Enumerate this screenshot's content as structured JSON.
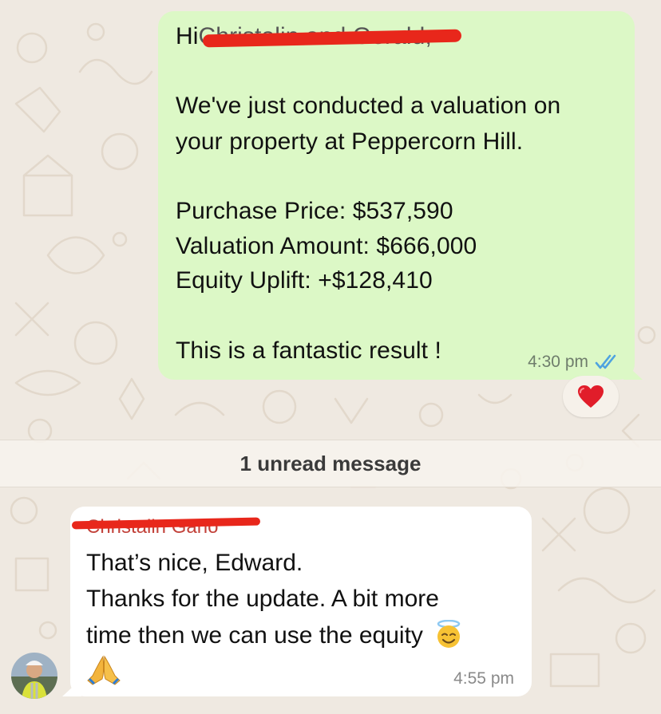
{
  "outgoing_message": {
    "greeting_prefix": "Hi",
    "greeting_redacted": "Christalin and Gerald,",
    "lines": [
      "We've just conducted a valuation on",
      "your property at Peppercorn Hill.",
      "Purchase Price: $537,590",
      "Valuation Amount: $666,000",
      "Equity Uplift: +$128,410",
      "This is a fantastic result !"
    ],
    "time": "4:30 pm",
    "status_icon": "double-check-read-icon",
    "reaction_icon": "red-heart-icon"
  },
  "unread_divider": {
    "label": "1 unread message"
  },
  "incoming_message": {
    "sender_redacted": "Christalin Gano",
    "lines": [
      "That’s nice, Edward.",
      "Thanks for the update. A bit more",
      "time then we can use the equity"
    ],
    "emoji_inline": "smiling-face-with-halo-icon",
    "emoji_line2": "folded-hands-icon",
    "time": "4:55 pm",
    "avatar_icon": "contact-avatar"
  },
  "colors": {
    "outgoing_bubble": "#dcf8c6",
    "incoming_bubble": "#ffffff",
    "redaction": "#e8271b",
    "read_ticks": "#4fa3e0",
    "wallpaper": "#efe9e1"
  }
}
